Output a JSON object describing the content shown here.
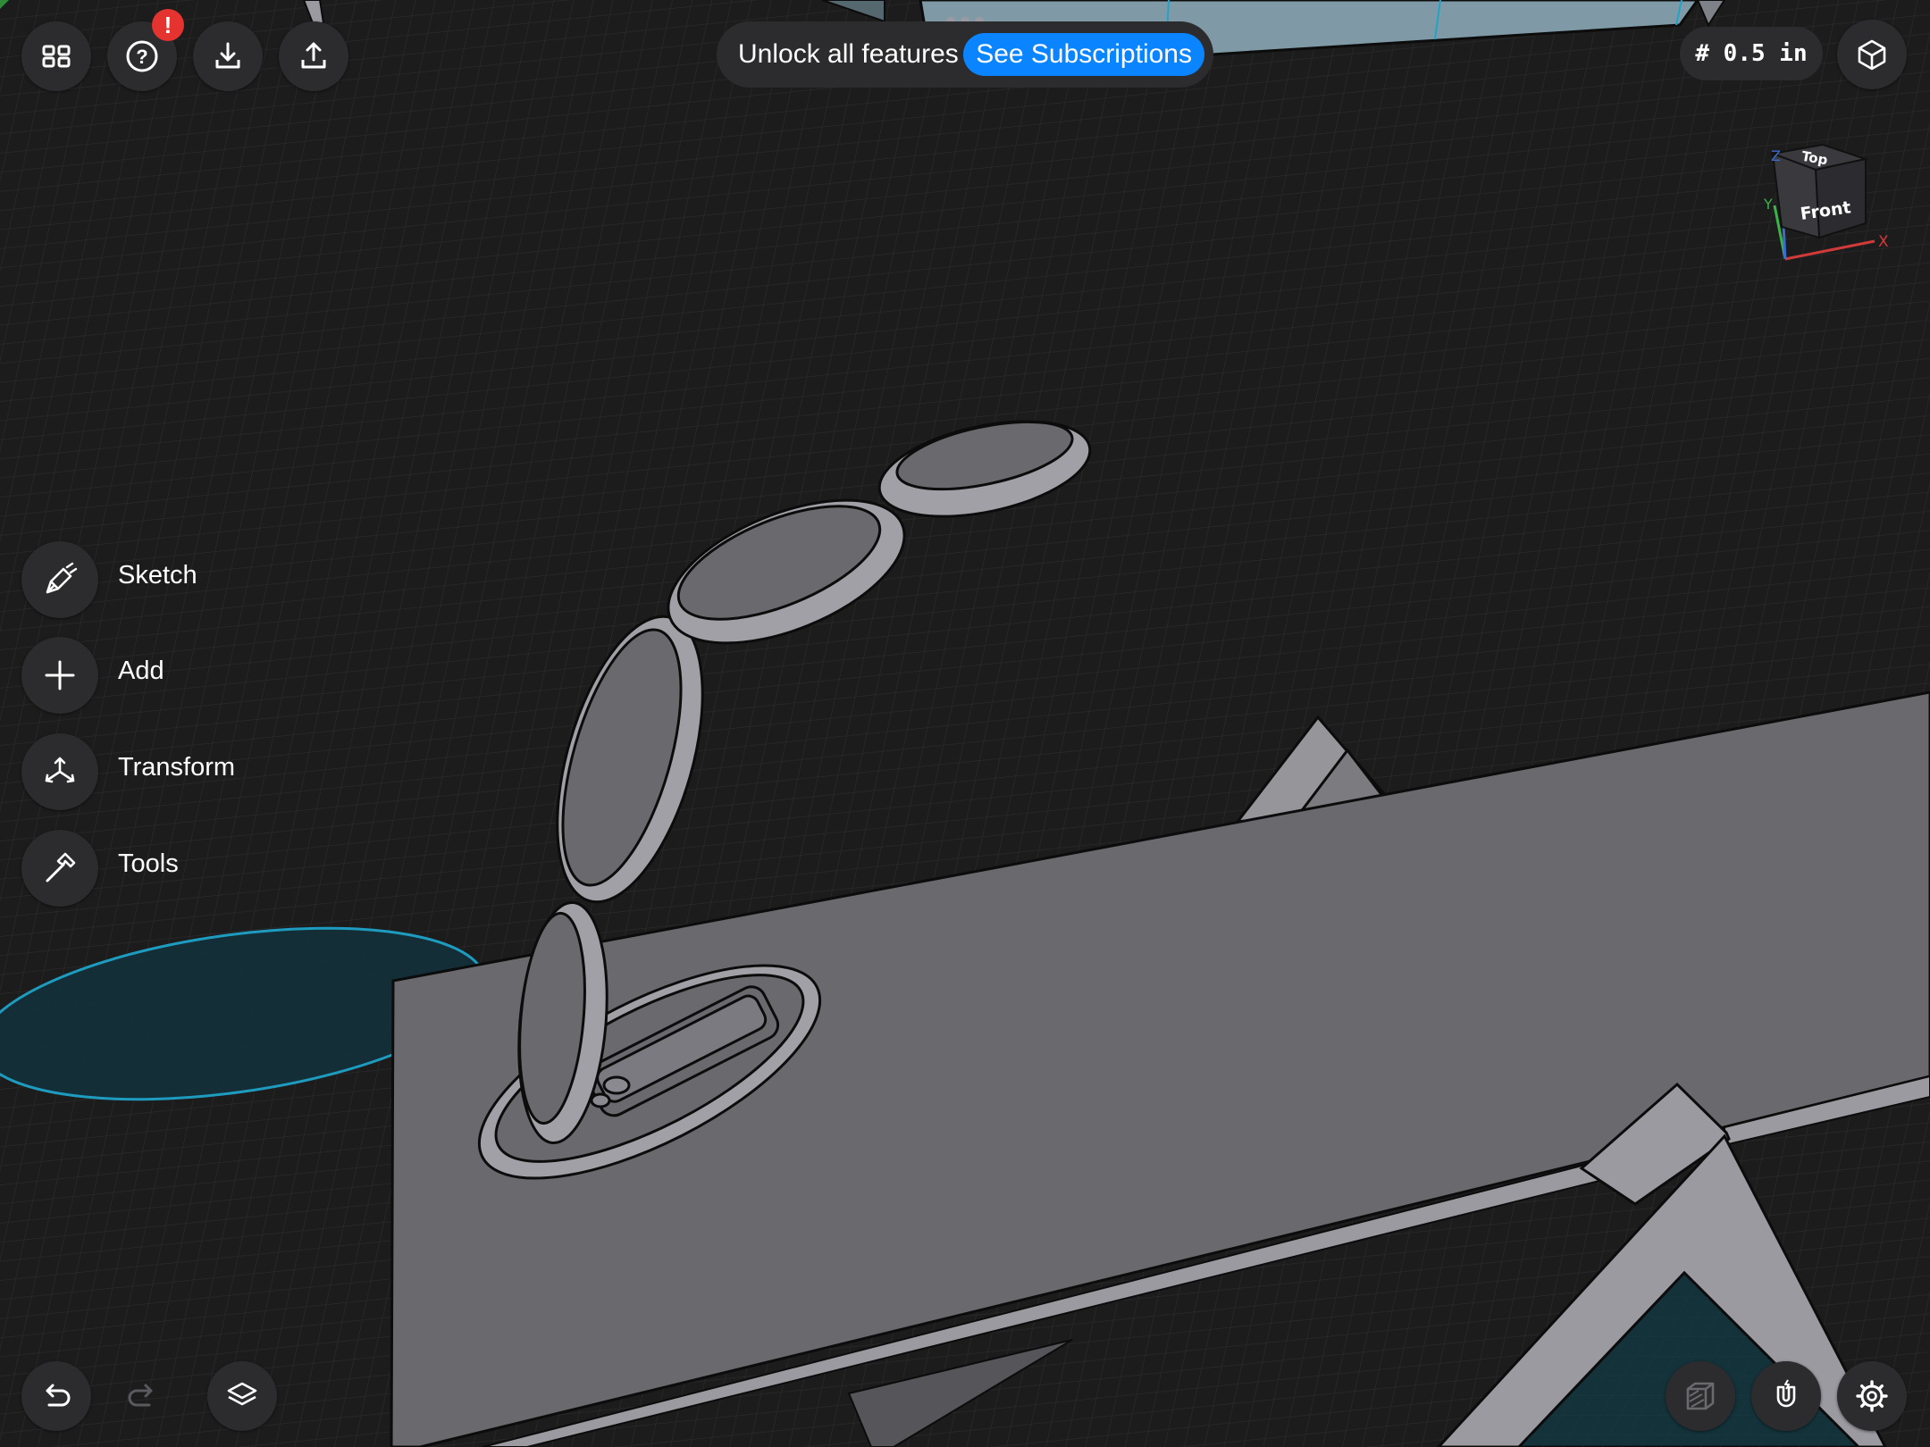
{
  "toolbar": {
    "gallery_icon": "grid-icon",
    "help_icon": "question-icon",
    "help_badge": "!",
    "import_icon": "import-icon",
    "export_icon": "share-icon"
  },
  "promo": {
    "text": "Unlock all features",
    "button_label": "See Subscriptions"
  },
  "grid_size": "# 0.5 in",
  "view_cube": {
    "top_label": "Top",
    "front_label": "Front",
    "axis_x": "X",
    "axis_y": "Y",
    "axis_z": "Z"
  },
  "side_menu": [
    {
      "label": "Sketch",
      "icon": "pen-icon"
    },
    {
      "label": "Add",
      "icon": "plus-icon"
    },
    {
      "label": "Transform",
      "icon": "move-arrows-icon"
    },
    {
      "label": "Tools",
      "icon": "hammer-icon"
    }
  ],
  "bottom_bar": {
    "undo_icon": "undo-icon",
    "redo_icon": "redo-icon",
    "layers_icon": "layers-icon",
    "view_mode_icon": "shaded-box-icon",
    "snap_icon": "magnet-icon",
    "settings_icon": "gear-icon"
  },
  "colors": {
    "background": "#1c1c1d",
    "accent": "#0a84ff",
    "badge": "#e5342f",
    "model_gray": "#6a6a6e",
    "selection_teal": "#1fa3c9"
  }
}
